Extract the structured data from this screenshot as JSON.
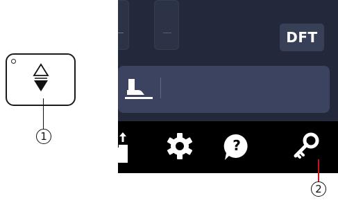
{
  "hardware_button": {
    "callout": "1",
    "icon": "needle-up-down-icon"
  },
  "screen": {
    "top_right_button_label": "DFT",
    "presser_foot_icon": "presser-foot-icon",
    "toolbar": {
      "items": [
        {
          "icon": "upload-icon"
        },
        {
          "icon": "gear-icon"
        },
        {
          "icon": "help-icon",
          "glyph": "?"
        },
        {
          "icon": "key-icon"
        }
      ]
    }
  },
  "callouts": {
    "one": "1",
    "two": "2"
  },
  "colors": {
    "screen_bg": "#23293a",
    "toolbar_bg": "#000000",
    "foot_bar": "#3b4360",
    "callout2_line": "#c4161c"
  }
}
